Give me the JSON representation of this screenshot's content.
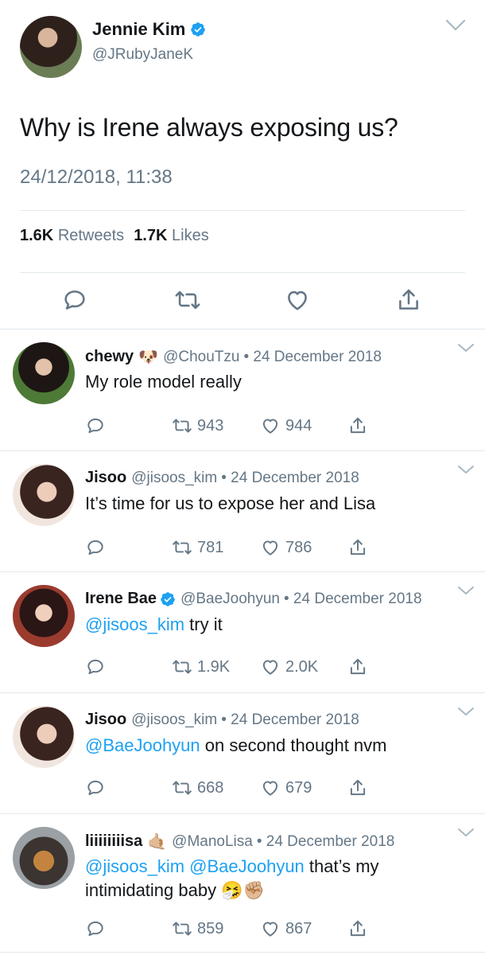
{
  "main": {
    "name": "Jennie Kim",
    "handle": "@JRubyJaneK",
    "text": "Why is Irene always exposing us?",
    "timestamp": "24/12/2018, 11:38",
    "retweets_count": "1.6K",
    "retweets_label": "Retweets",
    "likes_count": "1.7K",
    "likes_label": "Likes"
  },
  "replies": [
    {
      "name": "chewy",
      "emoji": "🐶",
      "handle": "@ChouTzu",
      "date": "• 24 December 2018",
      "text": "My role model really",
      "retweets": "943",
      "likes": "944"
    },
    {
      "name": "Jisoo",
      "handle": "@jisoos_kim",
      "date": "• 24 December 2018",
      "text": "It’s time for us to expose her and Lisa",
      "retweets": "781",
      "likes": "786"
    },
    {
      "name": "Irene Bae",
      "handle": "@BaeJoohyun",
      "date": "• 24 December 2018",
      "mention": "@jisoos_kim",
      "text": " try it",
      "retweets": "1.9K",
      "likes": "2.0K"
    },
    {
      "name": "Jisoo",
      "handle": "@jisoos_kim",
      "date": "• 24 December 2018",
      "mention": "@BaeJoohyun",
      "text": " on second thought nvm",
      "retweets": "668",
      "likes": "679"
    },
    {
      "name": "liiiiiiiisa",
      "emoji": "🤙🏼",
      "handle": "@ManoLisa",
      "date": "• 24 December 2018",
      "mention": "@jisoos_kim @BaeJoohyun",
      "text": " that’s my",
      "text2": "intimidating baby",
      "text2_emoji": "🤧✊🏼",
      "retweets": "859",
      "likes": "867"
    }
  ],
  "colors": {
    "accent": "#1da1f2",
    "muted": "#657786",
    "text": "#14171a",
    "divider": "#e1e8ed"
  }
}
